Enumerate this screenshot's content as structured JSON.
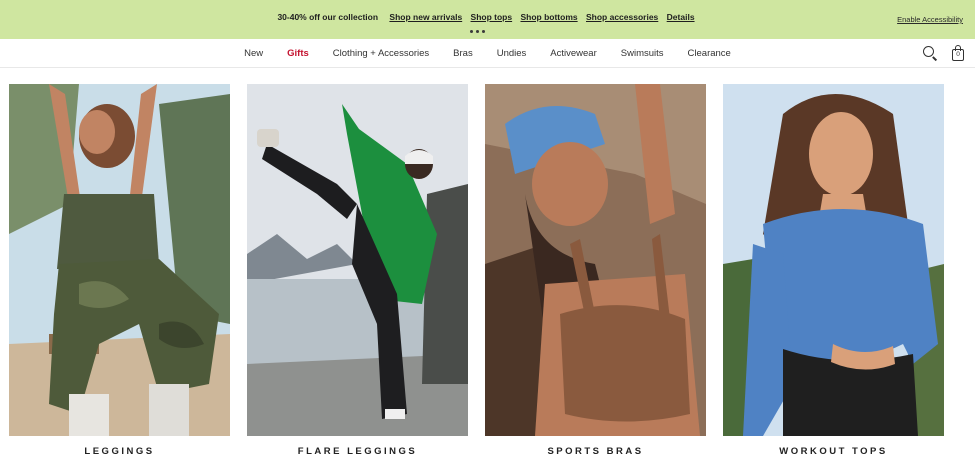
{
  "promo": {
    "message": "30-40% off our collection",
    "links": [
      "Shop new arrivals",
      "Shop tops",
      "Shop bottoms",
      "Shop accessories",
      "Details"
    ],
    "accessibility": "Enable Accessibility"
  },
  "nav": {
    "items": [
      "New",
      "Gifts",
      "Clothing + Accessories",
      "Bras",
      "Undies",
      "Activewear",
      "Swimsuits",
      "Clearance"
    ],
    "bag_count": "0"
  },
  "colors": {
    "banner": "#cfe6a0",
    "gifts": "#c4122f"
  },
  "tiles": [
    {
      "label": "LEGGINGS"
    },
    {
      "label": "FLARE LEGGINGS"
    },
    {
      "label": "SPORTS BRAS"
    },
    {
      "label": "WORKOUT TOPS"
    }
  ]
}
